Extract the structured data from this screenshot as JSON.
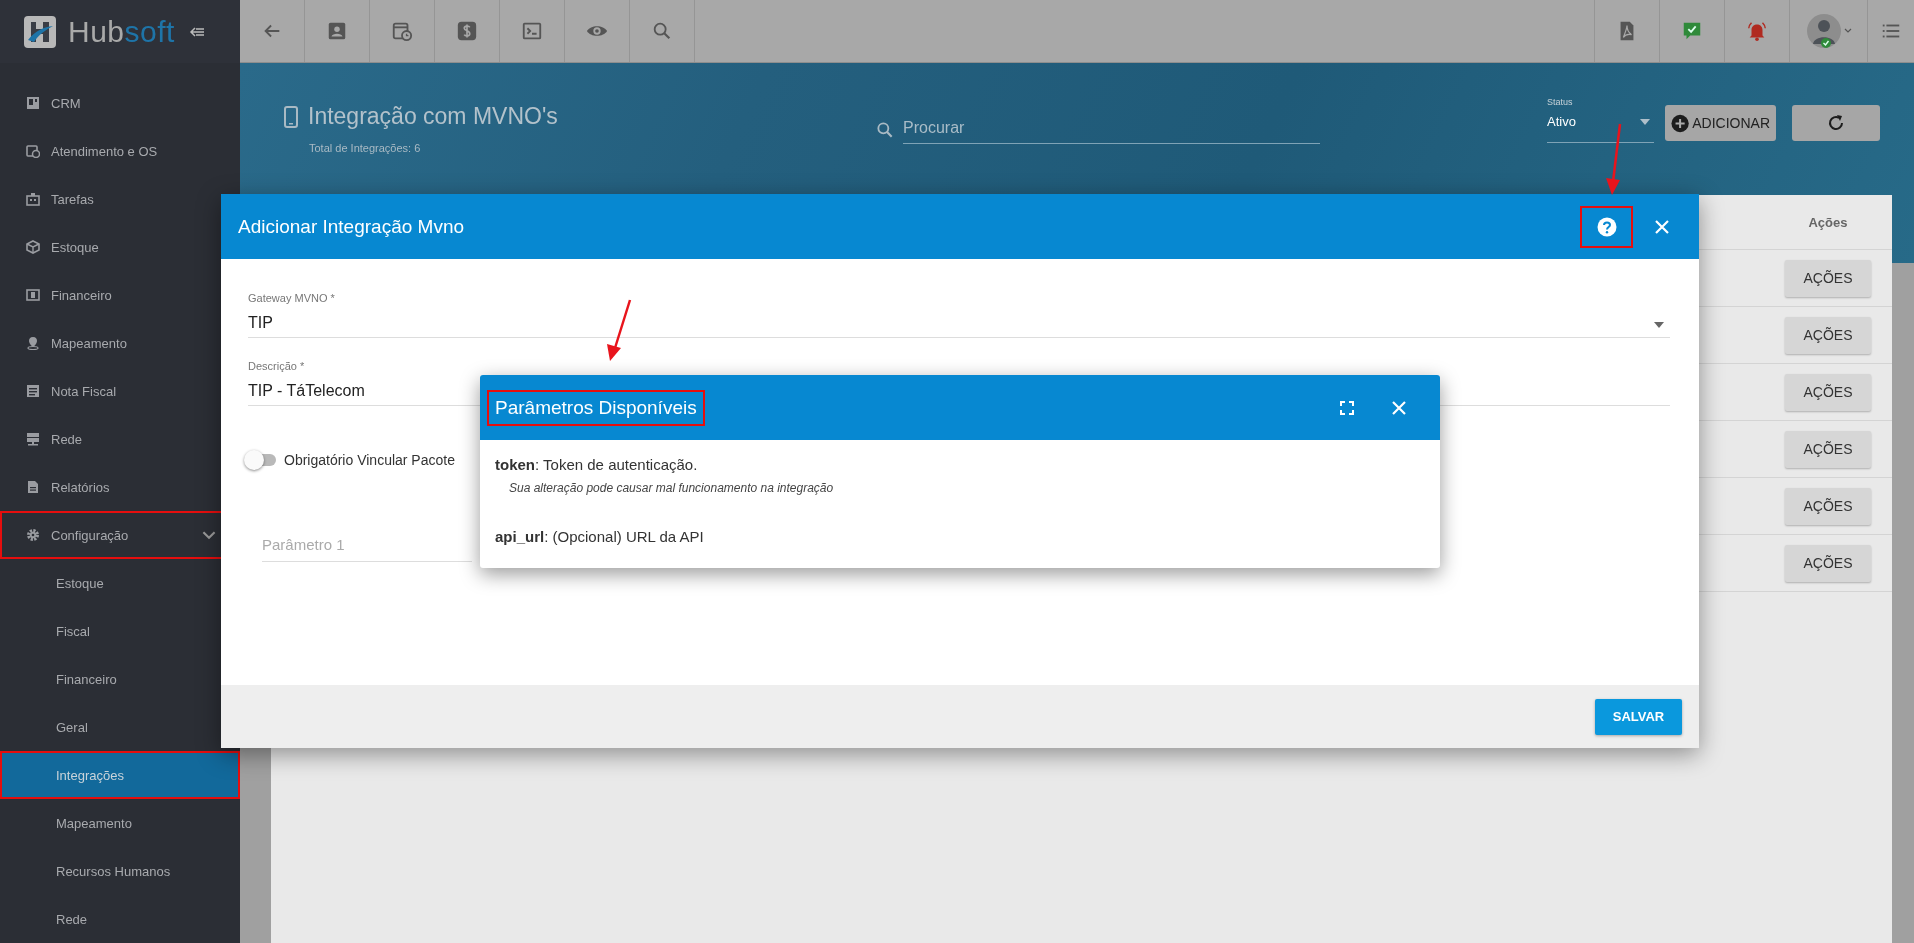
{
  "logo": {
    "parts": [
      "Hub",
      "soft"
    ]
  },
  "sidebar": {
    "items": [
      {
        "label": "CRM",
        "selected": false,
        "highlighted": false
      },
      {
        "label": "Atendimento e OS",
        "selected": false,
        "highlighted": false
      },
      {
        "label": "Tarefas",
        "selected": false,
        "highlighted": false
      },
      {
        "label": "Estoque",
        "selected": false,
        "highlighted": false
      },
      {
        "label": "Financeiro",
        "selected": false,
        "highlighted": false
      },
      {
        "label": "Mapeamento",
        "selected": false,
        "highlighted": false
      },
      {
        "label": "Nota Fiscal",
        "selected": false,
        "highlighted": false
      },
      {
        "label": "Rede",
        "selected": false,
        "highlighted": false
      },
      {
        "label": "Relatórios",
        "selected": false,
        "highlighted": false
      },
      {
        "label": "Configuração",
        "selected": false,
        "highlighted": true,
        "expanded": true,
        "children": [
          {
            "label": "Estoque",
            "selected": false,
            "highlighted": false
          },
          {
            "label": "Fiscal",
            "selected": false,
            "highlighted": false
          },
          {
            "label": "Financeiro",
            "selected": false,
            "highlighted": false
          },
          {
            "label": "Geral",
            "selected": false,
            "highlighted": false
          },
          {
            "label": "Integrações",
            "selected": true,
            "highlighted": true
          },
          {
            "label": "Mapeamento",
            "selected": false,
            "highlighted": false
          },
          {
            "label": "Recursos Humanos",
            "selected": false,
            "highlighted": false
          },
          {
            "label": "Rede",
            "selected": false,
            "highlighted": false
          }
        ]
      }
    ]
  },
  "header": {
    "title": "Integração com MVNO's",
    "subtitle": "Total de Integrações: 6",
    "search": {
      "placeholder": "Procurar"
    },
    "status": {
      "label": "Status",
      "value": "Ativo"
    },
    "add_button": "ADICIONAR"
  },
  "table": {
    "columns": [
      "Ações"
    ],
    "rows": [
      {
        "action": "AÇÕES"
      },
      {
        "action": "AÇÕES"
      },
      {
        "action": "AÇÕES"
      },
      {
        "action": "AÇÕES"
      },
      {
        "action": "AÇÕES"
      },
      {
        "action": "AÇÕES"
      }
    ]
  },
  "modal": {
    "title": "Adicionar Integração Mvno",
    "help_highlighted": true,
    "fields": [
      {
        "kind": "select",
        "label": "Gateway MVNO *",
        "value": "TIP"
      },
      {
        "kind": "text",
        "label": "Descrição *",
        "value": "TIP - TáTelecom"
      }
    ],
    "toggle": {
      "label": "Obrigatório Vincular Pacote",
      "on": false
    },
    "parameter": {
      "placeholder": "Parâmetro 1"
    },
    "save_button": "SALVAR"
  },
  "popup": {
    "title": "Parâmetros Disponíveis",
    "title_highlighted": true,
    "params": [
      {
        "text": "**token**: Token de autenticação.",
        "note": "Sua alteração pode causar mal funcionamento na integração"
      },
      {
        "text": "**api_url**: (Opcional) URL da API"
      }
    ]
  }
}
